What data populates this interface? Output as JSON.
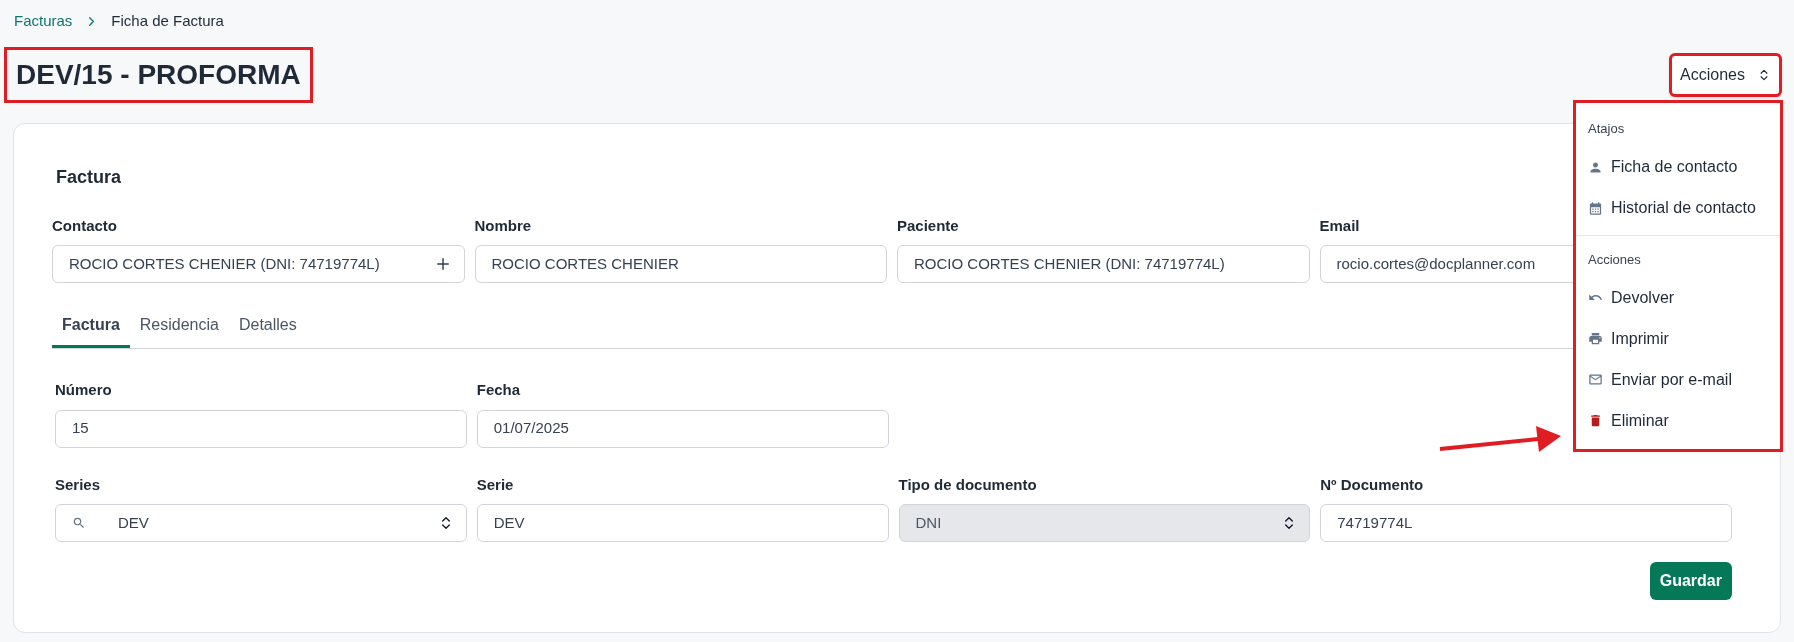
{
  "breadcrumb": [
    {
      "label": "Facturas",
      "kind": "link"
    },
    {
      "label": "Ficha de Factura",
      "kind": "current"
    }
  ],
  "page_title": {
    "text": "DEV/15 - PROFORMA",
    "highlighted": true
  },
  "actions_button": {
    "label": "Acciones",
    "highlighted": true,
    "expanded": true
  },
  "actions_menu": {
    "highlighted": true,
    "arrow": true,
    "sections": [
      {
        "heading": "Atajos",
        "items": [
          {
            "label": "Ficha de contacto",
            "kind": "normal"
          },
          {
            "label": "Historial de contacto",
            "kind": "normal"
          }
        ]
      },
      {
        "heading": "Acciones",
        "items": [
          {
            "label": "Devolver",
            "kind": "normal"
          },
          {
            "label": "Imprimir",
            "kind": "normal"
          },
          {
            "label": "Enviar por e-mail",
            "kind": "normal"
          },
          {
            "label": "Eliminar",
            "kind": "danger"
          }
        ]
      }
    ]
  },
  "card": {
    "title": "Factura",
    "contact_fields": [
      {
        "label": "Contacto",
        "value": "ROCIO CORTES CHENIER (DNI: 74719774L)",
        "kind": "lookup",
        "disabled": false
      },
      {
        "label": "Nombre",
        "value": "ROCIO CORTES CHENIER",
        "kind": "text",
        "disabled": false
      },
      {
        "label": "Paciente",
        "value": "ROCIO CORTES CHENIER (DNI: 74719774L)",
        "kind": "text",
        "disabled": false
      },
      {
        "label": "Email",
        "value": "rocio.cortes@docplanner.com",
        "kind": "text",
        "disabled": false
      }
    ],
    "tabs": [
      {
        "label": "Factura",
        "selected": true
      },
      {
        "label": "Residencia",
        "selected": false
      },
      {
        "label": "Detalles",
        "selected": false
      }
    ],
    "invoice_rows": [
      [
        {
          "label": "Número",
          "value": "15",
          "kind": "text",
          "disabled": false
        },
        {
          "label": "Fecha",
          "value": "01/07/2025",
          "kind": "text",
          "disabled": false
        }
      ],
      [
        {
          "label": "Series",
          "value": "DEV",
          "kind": "search-select",
          "disabled": false
        },
        {
          "label": "Serie",
          "value": "DEV",
          "kind": "text",
          "disabled": false
        },
        {
          "label": "Tipo de documento",
          "value": "DNI",
          "kind": "select",
          "disabled": true
        },
        {
          "label": "Nº Documento",
          "value": "74719774L",
          "kind": "text",
          "disabled": false
        }
      ]
    ],
    "save_button": "Guardar"
  }
}
